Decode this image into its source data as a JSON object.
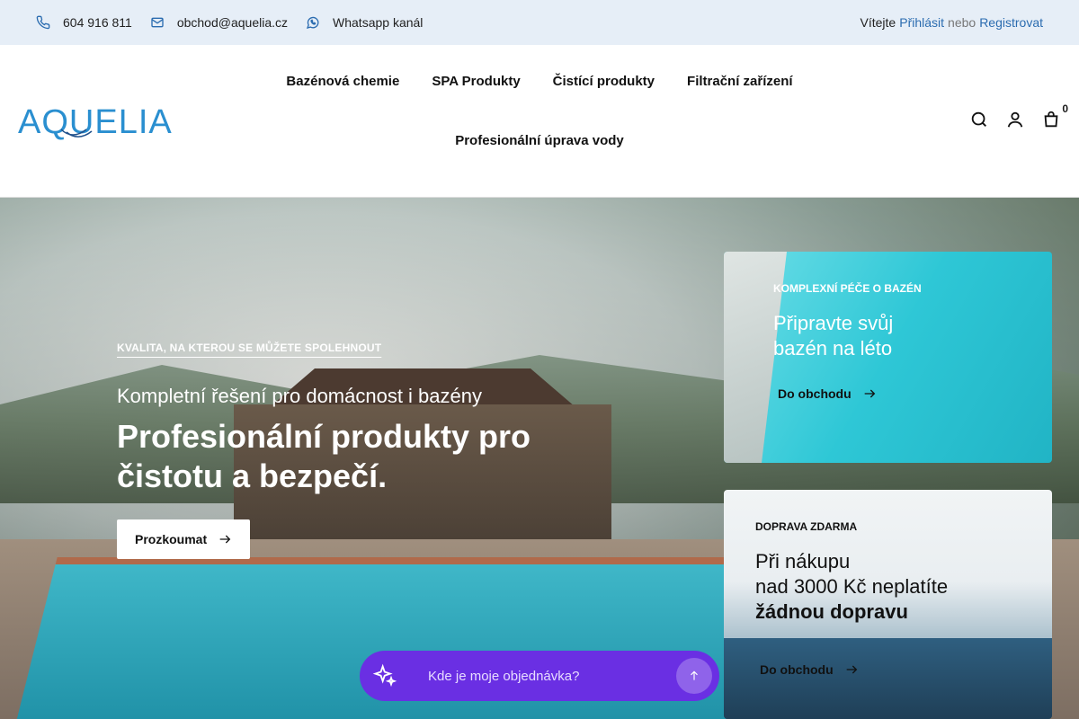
{
  "topbar": {
    "phone": "604 916 811",
    "email": "obchod@aquelia.cz",
    "whatsapp": "Whatsapp kanál",
    "welcome": "Vítejte",
    "login": "Přihlásit",
    "or": "nebo",
    "register": "Registrovat"
  },
  "header": {
    "logo": "AQUELIA",
    "nav": [
      "Bazénová chemie",
      "SPA Produkty",
      "Čistící produkty",
      "Filtrační zařízení",
      "Profesionální úprava vody"
    ],
    "cart_count": "0"
  },
  "hero": {
    "eyebrow": "Kvalita, na kterou se můžete spolehnout",
    "subtitle": "Kompletní řešení pro domácnost i bazény",
    "headline": "Profesionální produkty pro čistotu a bezpečí.",
    "cta": "Prozkoumat"
  },
  "cards": [
    {
      "tag": "Komplexní péče o bazén",
      "title": "Připravte svůj bazén na léto",
      "cta": "Do obchodu"
    },
    {
      "tag": "Doprava zdarma",
      "title_line1": "Při nákupu",
      "title_line2": "nad 3000 Kč neplatíte",
      "title_strong": "žádnou dopravu",
      "cta": "Do obchodu"
    }
  ],
  "chat": {
    "placeholder": "Kde je moje objednávka?"
  },
  "colors": {
    "topbar_bg": "#e6eef7",
    "link": "#2b6cb0",
    "logo": "#2a8fd0",
    "chat": "#6a2fe3"
  }
}
